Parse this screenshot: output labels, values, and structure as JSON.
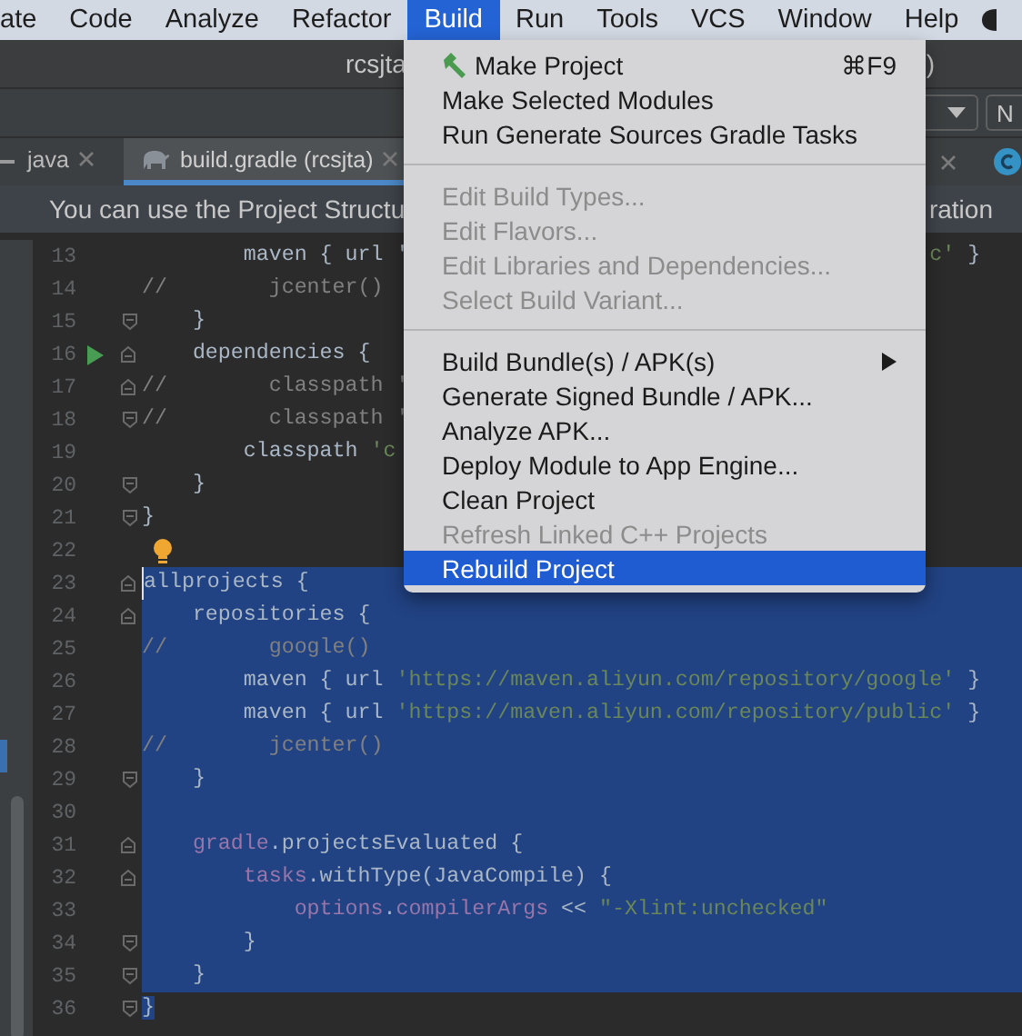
{
  "menu_bar": {
    "items": [
      {
        "label": "ate",
        "selected": false
      },
      {
        "label": "Code",
        "selected": false
      },
      {
        "label": "Analyze",
        "selected": false
      },
      {
        "label": "Refactor",
        "selected": false
      },
      {
        "label": "Build",
        "selected": true
      },
      {
        "label": "Run",
        "selected": false
      },
      {
        "label": "Tools",
        "selected": false
      },
      {
        "label": "VCS",
        "selected": false
      },
      {
        "label": "Window",
        "selected": false
      },
      {
        "label": "Help",
        "selected": false
      }
    ]
  },
  "window": {
    "title": "rcsjta",
    "title_tail": ")"
  },
  "toolbar": {
    "button_label": "N"
  },
  "tabs": [
    {
      "label": "java",
      "selected": false
    },
    {
      "label": "build.gradle (rcsjta)",
      "selected": true
    }
  ],
  "banner": {
    "text": "You can use the Project Structu",
    "tail": "ration"
  },
  "editor": {
    "lines": [
      {
        "number": "13",
        "fold_start": false,
        "fold_end": false,
        "runnable": false,
        "hint": false,
        "selected": false,
        "tokens": [
          {
            "kind": "plain",
            "text": "        maven { url '"
          }
        ],
        "tail": [
          {
            "kind": "string",
            "text": "c'"
          },
          {
            "kind": "plain",
            "text": " }"
          }
        ]
      },
      {
        "number": "14",
        "fold_start": false,
        "fold_end": false,
        "runnable": false,
        "hint": false,
        "selected": false,
        "tokens": [
          {
            "kind": "comment",
            "text": "//        jcenter()"
          }
        ]
      },
      {
        "number": "15",
        "fold_start": false,
        "fold_end": true,
        "runnable": false,
        "hint": false,
        "selected": false,
        "tokens": [
          {
            "kind": "plain",
            "text": "    }"
          }
        ]
      },
      {
        "number": "16",
        "fold_start": true,
        "fold_end": false,
        "runnable": true,
        "hint": false,
        "selected": false,
        "tokens": [
          {
            "kind": "plain",
            "text": "    dependencies {"
          }
        ]
      },
      {
        "number": "17",
        "fold_start": true,
        "fold_end": false,
        "runnable": false,
        "hint": false,
        "selected": false,
        "tokens": [
          {
            "kind": "comment",
            "text": "//        classpath '"
          }
        ]
      },
      {
        "number": "18",
        "fold_start": false,
        "fold_end": true,
        "runnable": false,
        "hint": false,
        "selected": false,
        "tokens": [
          {
            "kind": "comment",
            "text": "//        classpath '"
          }
        ]
      },
      {
        "number": "19",
        "fold_start": false,
        "fold_end": false,
        "runnable": false,
        "hint": false,
        "selected": false,
        "tokens": [
          {
            "kind": "plain",
            "text": "        classpath "
          },
          {
            "kind": "string",
            "text": "'c"
          }
        ]
      },
      {
        "number": "20",
        "fold_start": false,
        "fold_end": true,
        "runnable": false,
        "hint": false,
        "selected": false,
        "tokens": [
          {
            "kind": "plain",
            "text": "    }"
          }
        ]
      },
      {
        "number": "21",
        "fold_start": false,
        "fold_end": true,
        "runnable": false,
        "hint": false,
        "selected": false,
        "tokens": [
          {
            "kind": "plain",
            "text": "}"
          }
        ]
      },
      {
        "number": "22",
        "fold_start": false,
        "fold_end": false,
        "runnable": false,
        "hint": true,
        "selected": false
      },
      {
        "number": "23",
        "fold_start": true,
        "fold_end": false,
        "runnable": false,
        "hint": false,
        "selected": true,
        "caret": true,
        "tokens": [
          {
            "kind": "plain",
            "text": "allprojects {"
          }
        ]
      },
      {
        "number": "24",
        "fold_start": true,
        "fold_end": false,
        "runnable": false,
        "hint": false,
        "selected": true,
        "tokens": [
          {
            "kind": "plain",
            "text": "    repositories {"
          }
        ]
      },
      {
        "number": "25",
        "fold_start": false,
        "fold_end": false,
        "runnable": false,
        "hint": false,
        "selected": true,
        "tokens": [
          {
            "kind": "comment",
            "text": "//        google()"
          }
        ]
      },
      {
        "number": "26",
        "fold_start": false,
        "fold_end": false,
        "runnable": false,
        "hint": false,
        "selected": true,
        "tokens": [
          {
            "kind": "plain",
            "text": "        maven { url "
          },
          {
            "kind": "string",
            "text": "'https://maven.aliyun.com/repository/google'"
          },
          {
            "kind": "plain",
            "text": " }"
          }
        ]
      },
      {
        "number": "27",
        "fold_start": false,
        "fold_end": false,
        "runnable": false,
        "hint": false,
        "selected": true,
        "tokens": [
          {
            "kind": "plain",
            "text": "        maven { url "
          },
          {
            "kind": "string",
            "text": "'https://maven.aliyun.com/repository/public'"
          },
          {
            "kind": "plain",
            "text": " }"
          }
        ]
      },
      {
        "number": "28",
        "fold_start": false,
        "fold_end": false,
        "runnable": false,
        "hint": false,
        "selected": true,
        "tokens": [
          {
            "kind": "comment",
            "text": "//        jcenter()"
          }
        ]
      },
      {
        "number": "29",
        "fold_start": false,
        "fold_end": true,
        "runnable": false,
        "hint": false,
        "selected": true,
        "tokens": [
          {
            "kind": "plain",
            "text": "    }"
          }
        ]
      },
      {
        "number": "30",
        "fold_start": false,
        "fold_end": false,
        "runnable": false,
        "hint": false,
        "selected": true
      },
      {
        "number": "31",
        "fold_start": true,
        "fold_end": false,
        "runnable": false,
        "hint": false,
        "selected": true,
        "tokens": [
          {
            "kind": "property",
            "text": "    gradle"
          },
          {
            "kind": "plain",
            "text": ".projectsEvaluated {"
          }
        ]
      },
      {
        "number": "32",
        "fold_start": true,
        "fold_end": false,
        "runnable": false,
        "hint": false,
        "selected": true,
        "tokens": [
          {
            "kind": "property",
            "text": "        tasks"
          },
          {
            "kind": "plain",
            "text": ".withType(JavaCompile) {"
          }
        ]
      },
      {
        "number": "33",
        "fold_start": false,
        "fold_end": false,
        "runnable": false,
        "hint": false,
        "selected": true,
        "tokens": [
          {
            "kind": "property",
            "text": "            options"
          },
          {
            "kind": "plain",
            "text": "."
          },
          {
            "kind": "property",
            "text": "compilerArgs"
          },
          {
            "kind": "plain",
            "text": " << "
          },
          {
            "kind": "string",
            "text": "\"-Xlint:unchecked\""
          }
        ]
      },
      {
        "number": "34",
        "fold_start": false,
        "fold_end": true,
        "runnable": false,
        "hint": false,
        "selected": true,
        "tokens": [
          {
            "kind": "plain",
            "text": "        }"
          }
        ]
      },
      {
        "number": "35",
        "fold_start": false,
        "fold_end": true,
        "runnable": false,
        "hint": false,
        "selected": true,
        "tokens": [
          {
            "kind": "plain",
            "text": "    }"
          }
        ]
      },
      {
        "number": "36",
        "fold_start": false,
        "fold_end": true,
        "runnable": false,
        "hint": false,
        "selected": false,
        "tokens": [
          {
            "kind": "plain",
            "text": "}",
            "selected": true
          }
        ]
      }
    ]
  },
  "build_menu": {
    "items": [
      {
        "kind": "item",
        "label": "Make Project",
        "shortcut": "⌘F9",
        "disabled": false,
        "selected": false
      },
      {
        "kind": "item",
        "label": "Make Selected Modules",
        "disabled": false,
        "selected": false
      },
      {
        "kind": "item",
        "label": "Run Generate Sources Gradle Tasks",
        "disabled": false,
        "selected": false
      },
      {
        "kind": "separator"
      },
      {
        "kind": "item",
        "label": "Edit Build Types...",
        "disabled": true,
        "selected": false
      },
      {
        "kind": "item",
        "label": "Edit Flavors...",
        "disabled": true,
        "selected": false
      },
      {
        "kind": "item",
        "label": "Edit Libraries and Dependencies...",
        "disabled": true,
        "selected": false
      },
      {
        "kind": "item",
        "label": "Select Build Variant...",
        "disabled": true,
        "selected": false
      },
      {
        "kind": "separator"
      },
      {
        "kind": "item",
        "label": "Build Bundle(s) / APK(s)",
        "submenu": true,
        "disabled": false,
        "selected": false
      },
      {
        "kind": "item",
        "label": "Generate Signed Bundle / APK...",
        "disabled": false,
        "selected": false
      },
      {
        "kind": "item",
        "label": "Analyze APK...",
        "disabled": false,
        "selected": false
      },
      {
        "kind": "item",
        "label": "Deploy Module to App Engine...",
        "disabled": false,
        "selected": false
      },
      {
        "kind": "item",
        "label": "Clean Project",
        "disabled": false,
        "selected": false
      },
      {
        "kind": "item",
        "label": "Refresh Linked C++ Projects",
        "disabled": true,
        "selected": false
      },
      {
        "kind": "item",
        "label": "Rebuild Project",
        "disabled": false,
        "selected": true
      }
    ]
  }
}
